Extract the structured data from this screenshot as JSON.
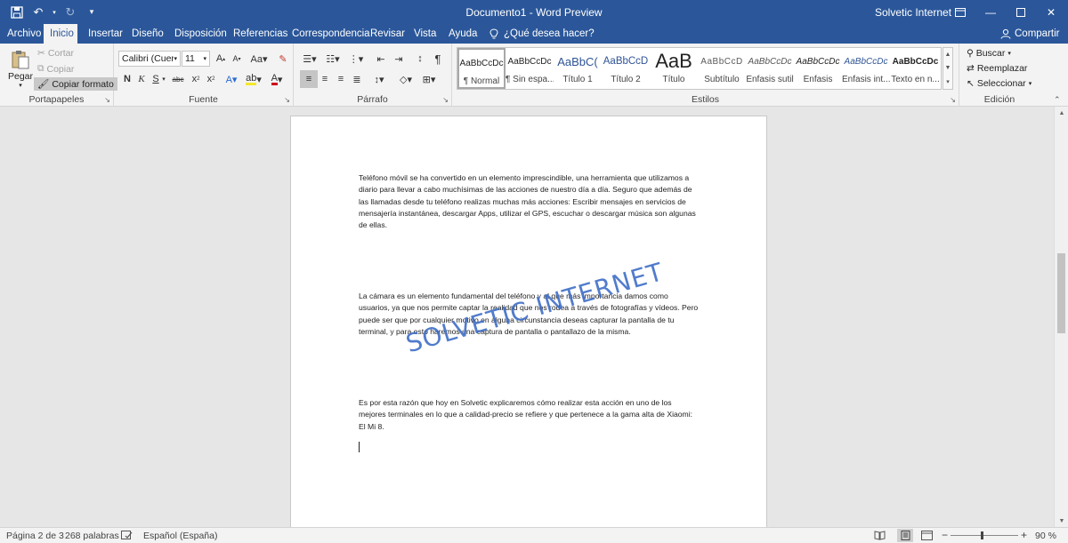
{
  "titlebar": {
    "document_title": "Documento1  -  Word Preview",
    "account": "Solvetic Internet",
    "bg_color": "#2b579a"
  },
  "tabs": [
    {
      "label": "Archivo",
      "active": false
    },
    {
      "label": "Inicio",
      "active": true
    },
    {
      "label": "Insertar",
      "active": false
    },
    {
      "label": "Diseño",
      "active": false
    },
    {
      "label": "Disposición",
      "active": false
    },
    {
      "label": "Referencias",
      "active": false
    },
    {
      "label": "Correspondencia",
      "active": false
    },
    {
      "label": "Revisar",
      "active": false
    },
    {
      "label": "Vista",
      "active": false
    },
    {
      "label": "Ayuda",
      "active": false
    }
  ],
  "tell_me": "¿Qué desea hacer?",
  "share_label": "Compartir",
  "ribbon": {
    "clipboard": {
      "label": "Portapapeles",
      "paste": "Pegar",
      "cut": "Cortar",
      "copy": "Copiar",
      "format_painter": "Copiar formato"
    },
    "font": {
      "label": "Fuente",
      "font_name": "Calibri (Cuerpo",
      "font_size": "11"
    },
    "paragraph": {
      "label": "Párrafo"
    },
    "styles": {
      "label": "Estilos",
      "items": [
        {
          "sample": "AaBbCcDc",
          "name": "¶ Normal"
        },
        {
          "sample": "AaBbCcDc",
          "name": "¶ Sin espa..."
        },
        {
          "sample": "AaBbC(",
          "name": "Título 1"
        },
        {
          "sample": "AaBbCcD",
          "name": "Título 2"
        },
        {
          "sample": "AaB",
          "name": "Título"
        },
        {
          "sample": "AaBbCcD",
          "name": "Subtítulo"
        },
        {
          "sample": "AaBbCcDc",
          "name": "Énfasis sutil"
        },
        {
          "sample": "AaBbCcDc",
          "name": "Énfasis"
        },
        {
          "sample": "AaBbCcDc",
          "name": "Énfasis int..."
        },
        {
          "sample": "AaBbCcDc",
          "name": "Texto en n..."
        }
      ]
    },
    "editing": {
      "label": "Edición",
      "find": "Buscar",
      "replace": "Reemplazar",
      "select": "Seleccionar"
    }
  },
  "document": {
    "paragraphs": [
      "Teléfono móvil se ha convertido en un elemento imprescindible, una herramienta que utilizamos a diario para llevar a cabo muchísimas de las acciones de nuestro día a día. Seguro que además de las llamadas desde tu teléfono realizas muchas más acciones: Escribir mensajes en servicios de mensajería instantánea, descargar Apps, utilizar el GPS, escuchar o descargar música son algunas de ellas.",
      "La cámara es un elemento fundamental del teléfono y al que más importancia damos como usuarios, ya que nos permite captar la realidad que nos rodea a través de fotografías y vídeos. Pero puede ser que por cualquier motivo en alguna circunstancia deseas capturar la pantalla de tu terminal, y para esto haremos una captura de pantalla o pantallazo de la misma.",
      "Es por esta razón que hoy en Solvetic explicaremos cómo realizar esta acción en uno de los mejores terminales en lo que a calidad-precio se refiere y que pertenece a la gama alta de Xiaomi: El Mi 8."
    ],
    "watermark": "SOLVETIC INTERNET"
  },
  "statusbar": {
    "page": "Página 2 de 3",
    "words": "268 palabras",
    "language": "Español (España)",
    "zoom": "90 %"
  }
}
